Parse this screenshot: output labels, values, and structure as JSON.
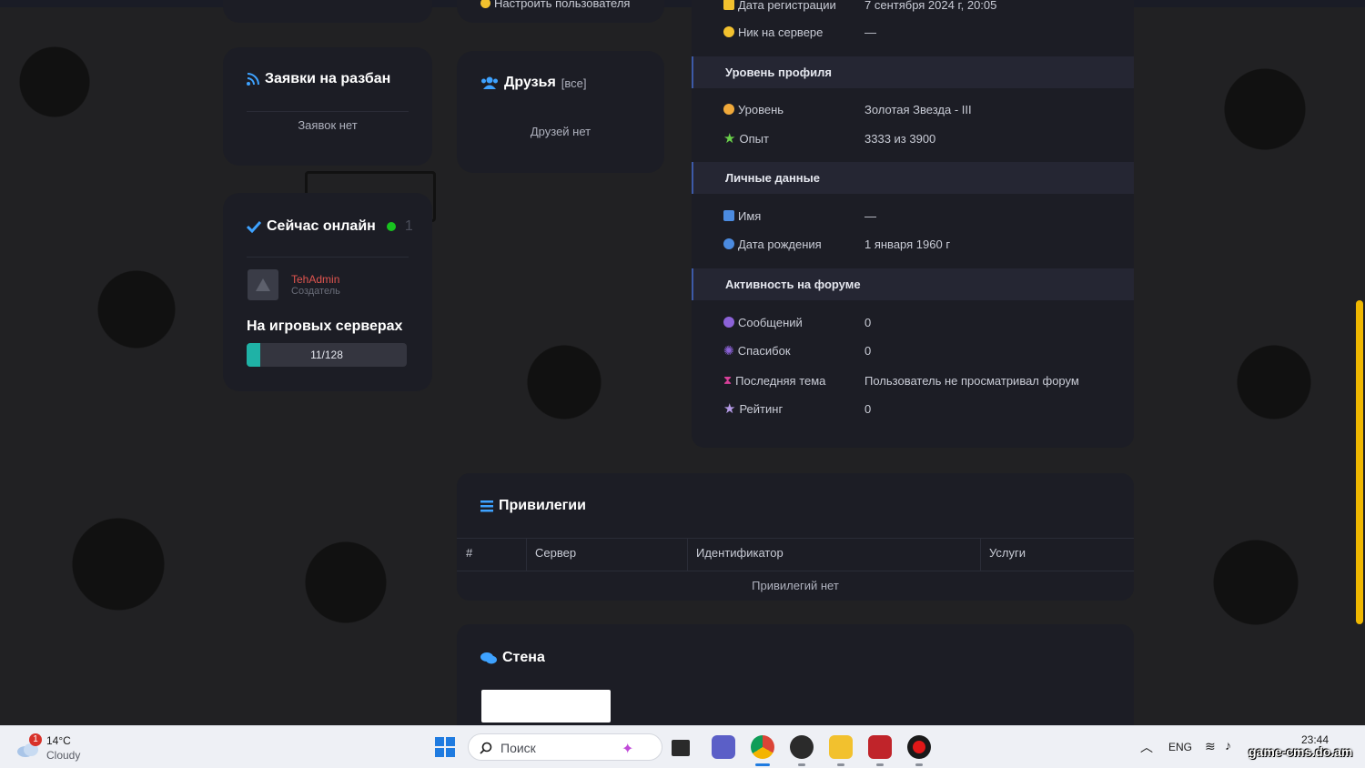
{
  "left": {
    "unban": {
      "title": "Заявки на разбан",
      "empty": "Заявок нет"
    },
    "online": {
      "title": "Сейчас онлайн",
      "count": "1",
      "user_name": "TehAdmin",
      "user_role": "Создатель",
      "servers_title": "На игровых серверах",
      "servers_progress_text": "11/128",
      "servers_fill_fraction": 0.086
    }
  },
  "middle": {
    "top_link": "Настроить пользователя",
    "friends": {
      "title": "Друзья",
      "all_label": "[все]",
      "empty": "Друзей нет"
    }
  },
  "profile": {
    "reg_date_label": "Дата регистрации",
    "reg_date_value": "7 сентября 2024 г, 20:05",
    "nick_label": "Ник на сервере",
    "nick_value": "—",
    "level_section": "Уровень профиля",
    "level_label": "Уровень",
    "level_value": "Золотая Звезда - III",
    "exp_label": "Опыт",
    "exp_value": "3333 из 3900",
    "personal_section": "Личные данные",
    "name_label": "Имя",
    "name_value": "—",
    "birth_label": "Дата рождения",
    "birth_value": "1 января 1960 г",
    "forum_section": "Активность на форуме",
    "messages_label": "Сообщений",
    "messages_value": "0",
    "thanks_label": "Спасибок",
    "thanks_value": "0",
    "last_topic_label": "Последняя тема",
    "last_topic_value": "Пользователь не просматривал форум",
    "rating_label": "Рейтинг",
    "rating_value": "0"
  },
  "privileges": {
    "title": "Привилегии",
    "columns": [
      "#",
      "Сервер",
      "Идентификатор",
      "Услуги"
    ],
    "empty": "Привилегий нет"
  },
  "wall": {
    "title": "Стена"
  },
  "taskbar": {
    "weather_temp": "14°C",
    "weather_desc": "Cloudy",
    "weather_badge": "1",
    "search_placeholder": "Поиск",
    "lang": "ENG",
    "time": "23:44",
    "watermark": "game-cms.do.am"
  },
  "colors": {
    "accent_blue": "#3ea2ff",
    "online_green": "#18c21f",
    "progress_teal": "#1fb2a6",
    "user_red": "#e0554f",
    "gold": "#f2c12e",
    "scroll": "#f0b800"
  }
}
